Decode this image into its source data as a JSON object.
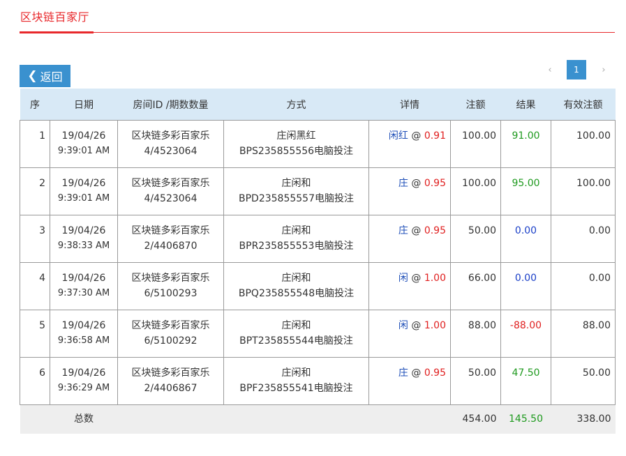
{
  "page": {
    "tab_title": "区块链百家厅",
    "back_label": "返回",
    "back_chevron": "❮",
    "pager": {
      "prev": "‹",
      "current": "1",
      "next": "›"
    }
  },
  "table": {
    "headers": [
      "序",
      "日期",
      "房间ID /期数数量",
      "方式",
      "详情",
      "注额",
      "结果",
      "有效注额"
    ],
    "rows": [
      {
        "idx": "1",
        "date": "19/04/26",
        "time": "9:39:01 AM",
        "room": "区块链多彩百家乐",
        "period": "4/4523064",
        "method": "庄闲黑红",
        "code": "BPS235855556电脑投注",
        "bet": "闲红",
        "at": "@",
        "odds": "0.91",
        "amount": "100.00",
        "result": "91.00",
        "result_color": "green",
        "valid": "100.00"
      },
      {
        "idx": "2",
        "date": "19/04/26",
        "time": "9:39:01 AM",
        "room": "区块链多彩百家乐",
        "period": "4/4523064",
        "method": "庄闲和",
        "code": "BPD235855557电脑投注",
        "bet": "庄",
        "at": "@",
        "odds": "0.95",
        "amount": "100.00",
        "result": "95.00",
        "result_color": "green",
        "valid": "100.00"
      },
      {
        "idx": "3",
        "date": "19/04/26",
        "time": "9:38:33 AM",
        "room": "区块链多彩百家乐",
        "period": "2/4406870",
        "method": "庄闲和",
        "code": "BPR235855553电脑投注",
        "bet": "庄",
        "at": "@",
        "odds": "0.95",
        "amount": "50.00",
        "result": "0.00",
        "result_color": "blue",
        "valid": "0.00"
      },
      {
        "idx": "4",
        "date": "19/04/26",
        "time": "9:37:30 AM",
        "room": "区块链多彩百家乐",
        "period": "6/5100293",
        "method": "庄闲和",
        "code": "BPQ235855548电脑投注",
        "bet": "闲",
        "at": "@",
        "odds": "1.00",
        "amount": "66.00",
        "result": "0.00",
        "result_color": "blue",
        "valid": "0.00"
      },
      {
        "idx": "5",
        "date": "19/04/26",
        "time": "9:36:58 AM",
        "room": "区块链多彩百家乐",
        "period": "6/5100292",
        "method": "庄闲和",
        "code": "BPT235855544电脑投注",
        "bet": "闲",
        "at": "@",
        "odds": "1.00",
        "amount": "88.00",
        "result": "-88.00",
        "result_color": "red",
        "valid": "88.00"
      },
      {
        "idx": "6",
        "date": "19/04/26",
        "time": "9:36:29 AM",
        "room": "区块链多彩百家乐",
        "period": "2/4406867",
        "method": "庄闲和",
        "code": "BPF235855541电脑投注",
        "bet": "庄",
        "at": "@",
        "odds": "0.95",
        "amount": "50.00",
        "result": "47.50",
        "result_color": "green",
        "valid": "50.00"
      }
    ],
    "footer": {
      "label": "总数",
      "amount": "454.00",
      "result": "145.50",
      "valid": "338.00"
    }
  },
  "colors": {
    "accent_red": "#e8282b",
    "button_blue": "#3a91cf",
    "header_bg": "#d8e9f6",
    "positive": "#1f9a1f",
    "negative": "#e02020",
    "zero": "#1a3fc8"
  }
}
